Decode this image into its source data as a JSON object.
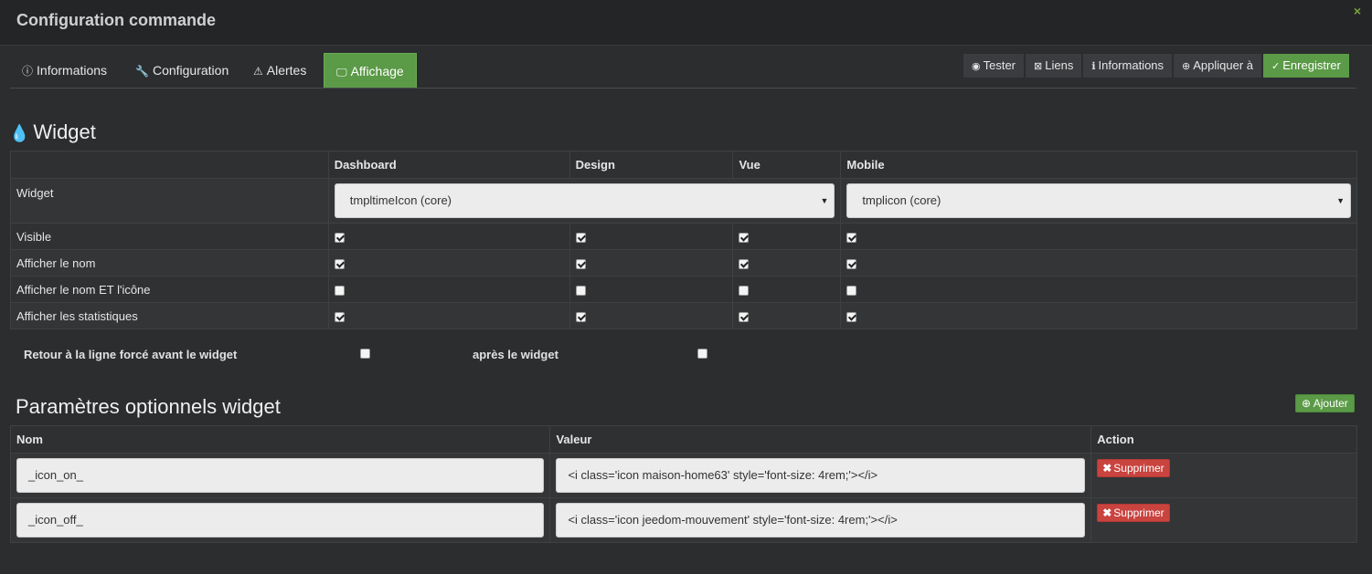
{
  "window": {
    "title": "Configuration commande",
    "close_icon": "×"
  },
  "tabs": [
    {
      "label": "Informations",
      "icon": "info-circle-icon",
      "glyph": "ⓘ"
    },
    {
      "label": "Configuration",
      "icon": "wrench-icon",
      "glyph": "🔧"
    },
    {
      "label": "Alertes",
      "icon": "warning-icon",
      "glyph": "⚠"
    },
    {
      "label": "Affichage",
      "icon": "desktop-icon",
      "glyph": "🖵",
      "active": true
    }
  ],
  "actions": [
    {
      "label": "Tester",
      "icon": "rss-icon",
      "glyph": "◉"
    },
    {
      "label": "Liens",
      "icon": "links-icon",
      "glyph": "⊠"
    },
    {
      "label": "Informations",
      "icon": "info-icon",
      "glyph": "ℹ"
    },
    {
      "label": "Appliquer à",
      "icon": "plus-circle-icon",
      "glyph": "⊕"
    },
    {
      "label": "Enregistrer",
      "icon": "check-circle-icon",
      "glyph": "✓"
    }
  ],
  "widget_section": {
    "title": "Widget",
    "icon_glyph": "💧",
    "columns": [
      "Dashboard",
      "Design",
      "Vue",
      "Mobile"
    ],
    "widget_row_label": "Widget",
    "dashboard_select": "tmpltimeIcon (core)",
    "mobile_select": "tmplicon (core)",
    "select_arrow": "▼",
    "rows": [
      {
        "label": "Visible",
        "checks": [
          true,
          true,
          true,
          true
        ]
      },
      {
        "label": "Afficher le nom",
        "checks": [
          true,
          true,
          true,
          true
        ]
      },
      {
        "label": "Afficher le nom ET l'icône",
        "checks": [
          false,
          false,
          false,
          false
        ]
      },
      {
        "label": "Afficher les statistiques",
        "checks": [
          true,
          true,
          true,
          true
        ]
      }
    ]
  },
  "line_break": {
    "before_label": "Retour à la ligne forcé avant le widget",
    "before_checked": false,
    "after_label": "après le widget",
    "after_checked": false
  },
  "params_section": {
    "title": "Paramètres optionnels widget",
    "add_label": "Ajouter",
    "add_glyph": "⊕",
    "columns": [
      "Nom",
      "Valeur",
      "Action"
    ],
    "delete_label": "Supprimer",
    "delete_glyph": "✖",
    "rows": [
      {
        "name": "_icon_on_",
        "value": "<i class='icon maison-home63' style='font-size: 4rem;'></i>"
      },
      {
        "name": "_icon_off_",
        "value": "<i class='icon jeedom-mouvement' style='font-size: 4rem;'></i>"
      }
    ]
  }
}
